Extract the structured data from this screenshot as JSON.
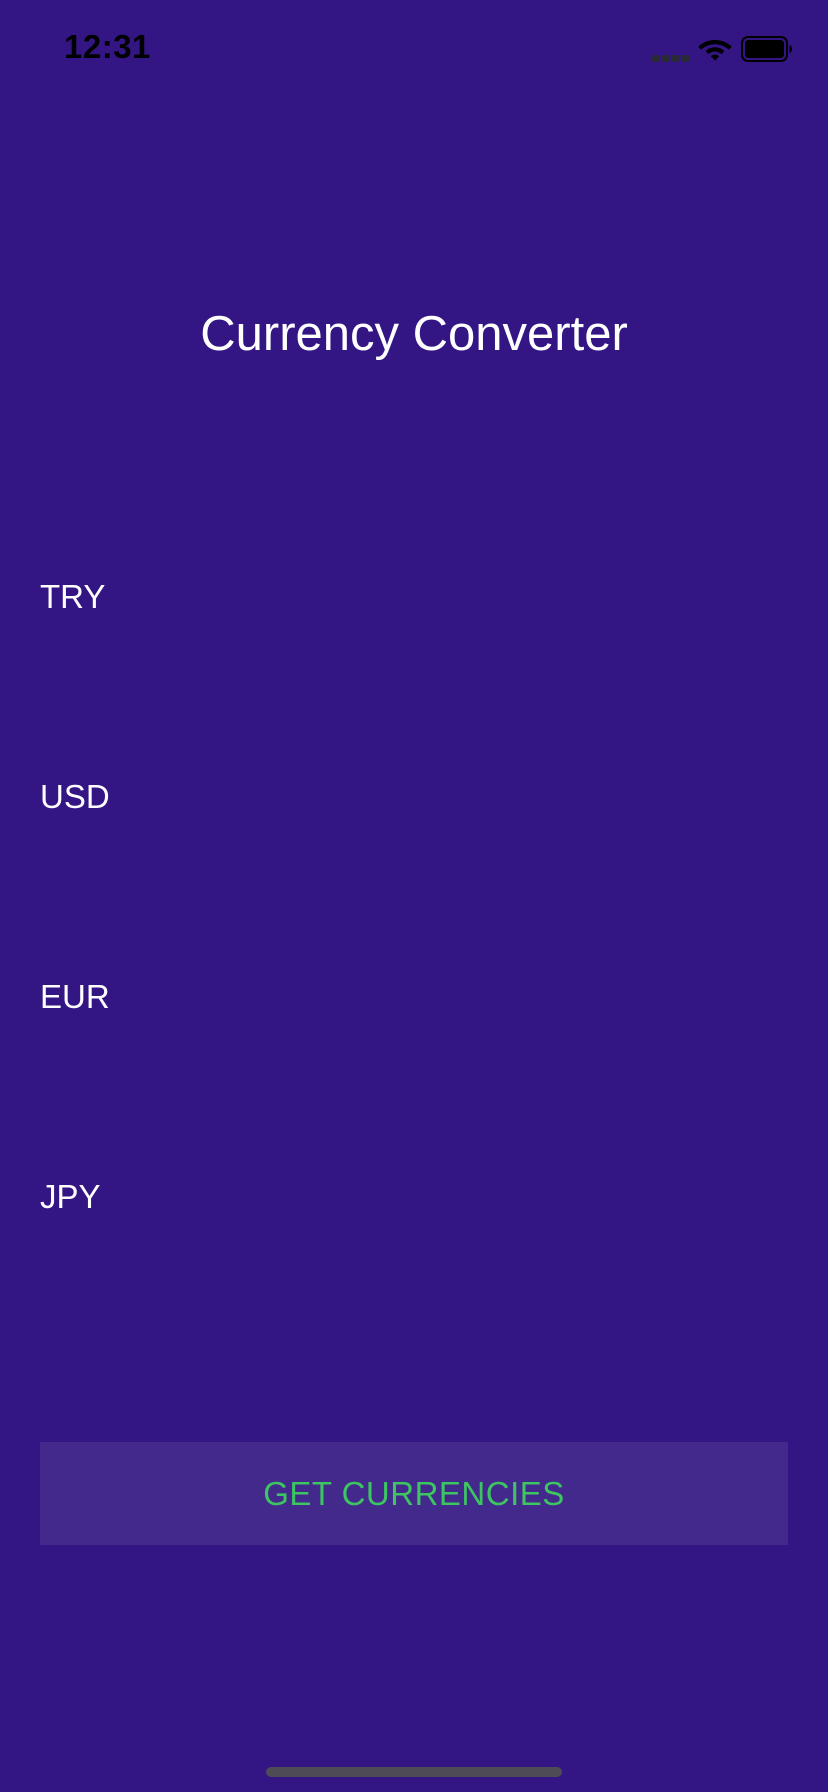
{
  "status_bar": {
    "time": "12:31",
    "icons": [
      "cellular-signal-icon",
      "wifi-icon",
      "battery-icon"
    ]
  },
  "title": "Currency Converter",
  "currencies": [
    {
      "code": "TRY"
    },
    {
      "code": "USD"
    },
    {
      "code": "EUR"
    },
    {
      "code": "JPY"
    }
  ],
  "button": {
    "label": "GET CURRENCIES"
  },
  "colors": {
    "background": "#341584",
    "button_background": "#43298b",
    "button_text": "#3cc561",
    "text": "#ffffff",
    "status_bar_text": "#000000",
    "home_indicator": "#4e4b55"
  }
}
